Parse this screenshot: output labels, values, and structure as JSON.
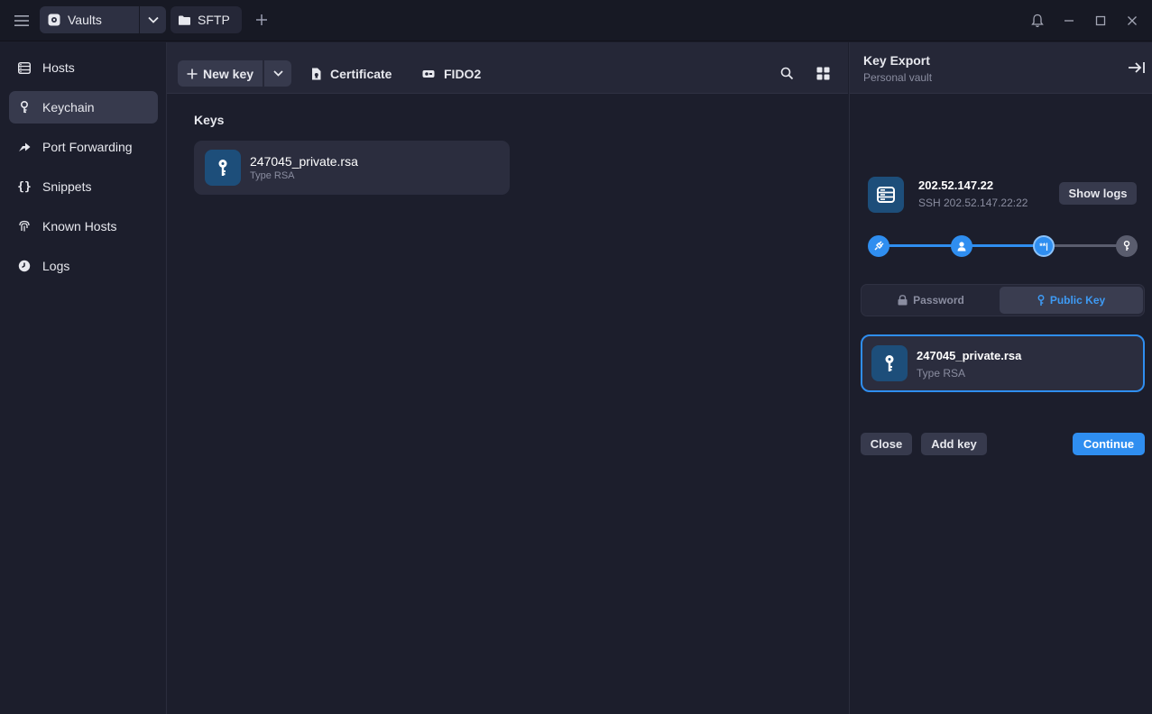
{
  "titlebar": {
    "tabs": [
      {
        "label": "Vaults",
        "icon": "vault-icon"
      },
      {
        "label": "SFTP",
        "icon": "folder-icon"
      }
    ]
  },
  "sidebar": {
    "items": [
      {
        "label": "Hosts",
        "icon": "server-icon",
        "active": false
      },
      {
        "label": "Keychain",
        "icon": "key-icon",
        "active": true
      },
      {
        "label": "Port Forwarding",
        "icon": "forward-icon",
        "active": false
      },
      {
        "label": "Snippets",
        "icon": "braces-icon",
        "active": false
      },
      {
        "label": "Known Hosts",
        "icon": "fingerprint-icon",
        "active": false
      },
      {
        "label": "Logs",
        "icon": "clock-icon",
        "active": false
      }
    ]
  },
  "toolbar": {
    "new_key_label": "New key",
    "certificate_label": "Certificate",
    "fido2_label": "FIDO2"
  },
  "keys_section": {
    "title": "Keys",
    "items": [
      {
        "name": "247045_private.rsa",
        "type": "Type RSA"
      }
    ]
  },
  "panel": {
    "title": "Key Export",
    "subtitle": "Personal vault",
    "host": {
      "address": "202.52.147.22",
      "detail": "SSH 202.52.147.22:22"
    },
    "show_logs_label": "Show logs",
    "steps": [
      {
        "icon": "plug-icon",
        "state": "done"
      },
      {
        "icon": "user-icon",
        "state": "done"
      },
      {
        "icon": "password-icon",
        "state": "current",
        "text": "**|"
      },
      {
        "icon": "key-icon",
        "state": "pending"
      }
    ],
    "auth_options": {
      "password_label": "Password",
      "public_key_label": "Public Key",
      "selected": "Public Key"
    },
    "selected_key": {
      "name": "247045_private.rsa",
      "type": "Type RSA"
    },
    "buttons": {
      "close": "Close",
      "add_key": "Add key",
      "continue": "Continue"
    }
  },
  "colors": {
    "accent": "#2f8ef0",
    "background": "#1c1e2c",
    "panel": "#252737",
    "card": "#2b2d3e",
    "icon_tile": "#1d4e7a"
  }
}
